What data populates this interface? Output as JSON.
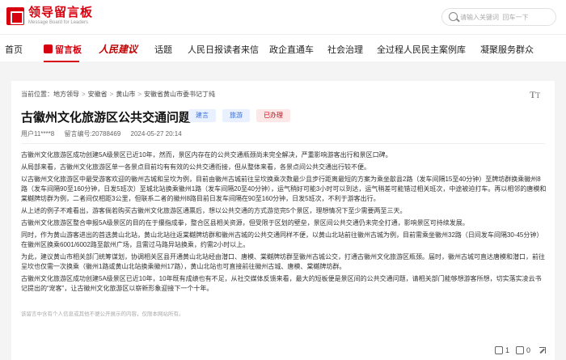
{
  "header": {
    "logo_cn": "领导留言板",
    "logo_en": "Message Board for Leaders",
    "search_placeholder": "请输入关键词  回车一下"
  },
  "nav": {
    "items": [
      {
        "label": "首页"
      },
      {
        "label": "留言板",
        "active": true
      },
      {
        "label": "人民建议"
      },
      {
        "label": "话题"
      },
      {
        "label": "人民日报读者来信"
      },
      {
        "label": "政企直通车"
      },
      {
        "label": "社会治理"
      },
      {
        "label": "全过程人民民主案例库"
      },
      {
        "label": "凝聚服务群众"
      }
    ]
  },
  "breadcrumb": {
    "prefix": "当前位置：",
    "items": [
      "地方领导",
      "安徽省",
      "黄山市",
      "安徽省黄山市委书记丁纯"
    ]
  },
  "post": {
    "title": "古徽州文化旅游区公共交通问题",
    "tags": [
      "建言",
      "旅游",
      "已办理"
    ],
    "author": "用户11****8",
    "id": "留言编号:20788469",
    "date": "2024-05-27 20:14",
    "paragraphs": [
      "古徽州文化旅游区成功创建5A级景区已近10年，然而，景区内存在的公共交通瓶颈尚未完全解决，严重影响游客出行和景区口碑。",
      "从局部来看，古徽州文化旅游区单一各景点目前均有有效的公共交通衔接，但从整体来看，各景点间公共交通出行较不便。",
      "以古徽州文化旅游区中最受游客欢迎的徽州古城和呈坎为例，目前由徽州古城前往呈坎换乘次数最少且步行距离最短的方案为乘坐歙县2路（发车间隔15至40分钟）至牌坊群换乘徽州8路（发车间隔90至160分钟，日发5班次）至城北站换乘徽州1路（发车间隔20至40分钟），运气稍好可能3小时可以到达，运气稍差可能错过相关班次，中途被迫打车。再以相邻的唐模和棠樾牌坊群为例，二者间仅相距3公里，但联系二者的徽州8路目前日发车间隔在90至160分钟，日发5班次，不利于游客出行。",
      "从上述的例子不难看出，游客倘若购买古徽州文化旅游区通票后，想以公共交通的方式游览完5个景区，理想情况下至少需要两至三天。",
      "古徽州文化旅游区整合申报5A级景区的目的在于攥指成拳，整合区县相关资源，但受限于区划的壁垒，景区间公共交通仍未完全打通，影响景区可持续发展。",
      "同时，作为黄山游客进出的首选黄山北站，黄山北站往返棠樾牌坊群和徽州古城的公共交通同样不便，以黄山北站前往徽州古城为例，目前需乘坐徽州32路（日间发车间隔30-45分钟）在徽州区换乘6001/6002路至歙州广场，且需过马路异站换乘，约需2小时以上。",
      "为此，建议黄山市相关部门统筹谋划，协调相关区县开通黄山北站经由潜口、唐模、棠樾牌坊群至徽州古城公交，打通古徽州文化旅游区瓶颈。届时，徽州古城可直达唐模和潜口，前往呈坎也仅需一次换乘（徽州1路或黄山北站换乘徽州17路），黄山北站也可直接前往徽州古城、唐模、棠樾牌坊群。",
      "古徽州文化旅游区成功创建5A级景区已近10年，10年既有成绩也有不足，从社交媒体反馈来看，最大的短板便是景区间的公共交通问题，请相关部门能够想游客所想，切实落实凌云书记提出的“宠客”，让古徽州文化旅游区以崭新形象迎接下一个十年。"
    ],
    "disclaimer": "该留言中含有个人信息或其他不便公开展示的内容，仅限本网站所有。"
  },
  "actions": {
    "like_count": "1",
    "dislike_count": "0"
  }
}
